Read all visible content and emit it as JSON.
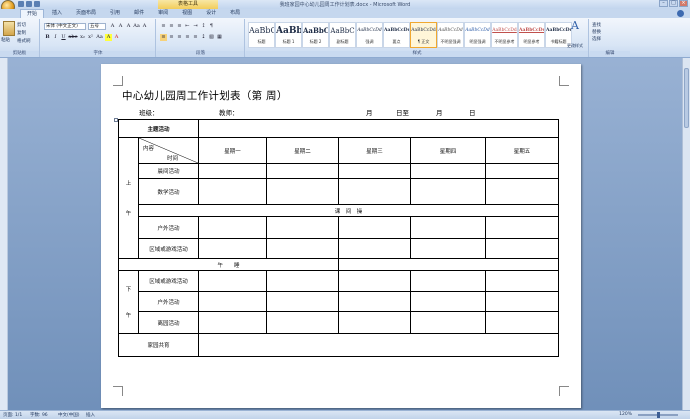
{
  "window": {
    "title": "我班家园中心幼儿园周工作计划表.docx - Microsoft Word",
    "context_tab": "表格工具",
    "controls": [
      "–",
      "□",
      "×"
    ]
  },
  "ribbon_tabs": [
    "开始",
    "插入",
    "页面布局",
    "引用",
    "邮件",
    "审阅",
    "视图",
    "设计",
    "布局"
  ],
  "clipboard": {
    "paste": "粘贴",
    "items": [
      "剪切",
      "复制",
      "格式刷"
    ],
    "label": "剪贴板"
  },
  "font": {
    "name": "宋体 (中文正文)",
    "size": "五号",
    "label": "字体",
    "row1": [
      "A",
      "A",
      "A",
      "Aa",
      "A"
    ],
    "row2": [
      "B",
      "I",
      "U",
      "abe",
      "x₂",
      "x²",
      "Aa",
      "A",
      "A"
    ]
  },
  "paragraph": {
    "label": "段落"
  },
  "styles": {
    "label": "样式",
    "items": [
      {
        "sample": "AaBbC",
        "name": "标题"
      },
      {
        "sample": "AaBb",
        "name": "标题 1"
      },
      {
        "sample": "AaBbC",
        "name": "标题 2"
      },
      {
        "sample": "AaBbC",
        "name": "副标题"
      },
      {
        "sample": "AaBbCcDd",
        "name": "强调"
      },
      {
        "sample": "AaBbCcDd",
        "name": "要点"
      },
      {
        "sample": "AaBbCcDd",
        "name": "¶ 正文"
      },
      {
        "sample": "AaBbCcDd",
        "name": "不明显强调"
      },
      {
        "sample": "AaBbCcDd",
        "name": "明显强调"
      },
      {
        "sample": "AaBbCcDd",
        "name": "不明显参考"
      },
      {
        "sample": "AaBbCcDd",
        "name": "明显参考"
      },
      {
        "sample": "AaBbCcDd",
        "name": "书籍标题"
      }
    ],
    "selected_index": 6,
    "change": "更改样式"
  },
  "editing": {
    "items": [
      "查找",
      "替换",
      "选择"
    ],
    "label": "编辑"
  },
  "document": {
    "title": "中心幼儿园周工作计划表（第    周）",
    "class_label": "班级：",
    "teacher_label": "教师：",
    "date_range": [
      "月",
      "日至",
      "月",
      "日"
    ],
    "table": {
      "main_activity": "主题活动",
      "content": "内容",
      "time": "时间",
      "days": [
        "星期一",
        "星期二",
        "星期三",
        "星期四",
        "星期五"
      ],
      "morning_label": [
        "上",
        "午"
      ],
      "morning_rows": [
        "晨间活动",
        "数学活动"
      ],
      "break": "课　间　操",
      "morning_rows2": [
        "户外活动",
        "区域或游戏活动"
      ],
      "noon": "午　　睡",
      "afternoon_label": [
        "下",
        "午"
      ],
      "afternoon_rows": [
        "区域或游戏活动",
        "户外活动",
        "离园活动"
      ],
      "family": "家园共育"
    }
  },
  "status": {
    "page": "页面: 1/1",
    "words": "字数: 96",
    "lang": "中文(中国)",
    "insert": "插入",
    "zoom": "120%"
  }
}
